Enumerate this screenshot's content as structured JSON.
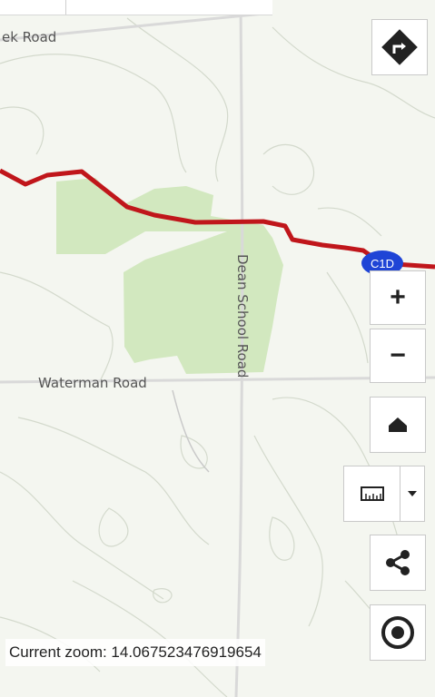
{
  "map": {
    "roads": [
      {
        "name": "ek Road"
      },
      {
        "name": "Waterman Road"
      },
      {
        "name": "Dean School Road"
      }
    ],
    "route": {
      "label": "C1D",
      "color": "#c0161b",
      "badge_color": "#1f44d6"
    },
    "colors": {
      "background": "#f4f6f0",
      "forest": "#cfe6b8",
      "contour": "#cfd6c8",
      "road": "#dcdcdc"
    }
  },
  "controls": {
    "directions": {
      "icon": "directions-icon"
    },
    "zoom_in": {
      "label": "+"
    },
    "zoom_out": {
      "label": "−"
    },
    "home": {
      "icon": "home-icon"
    },
    "measure": {
      "icon": "ruler-icon",
      "dropdown_icon": "caret-down-icon"
    },
    "share": {
      "icon": "share-icon"
    },
    "locate": {
      "icon": "locate-icon"
    }
  },
  "status": {
    "zoom_text": "Current zoom: 14.067523476919654"
  }
}
